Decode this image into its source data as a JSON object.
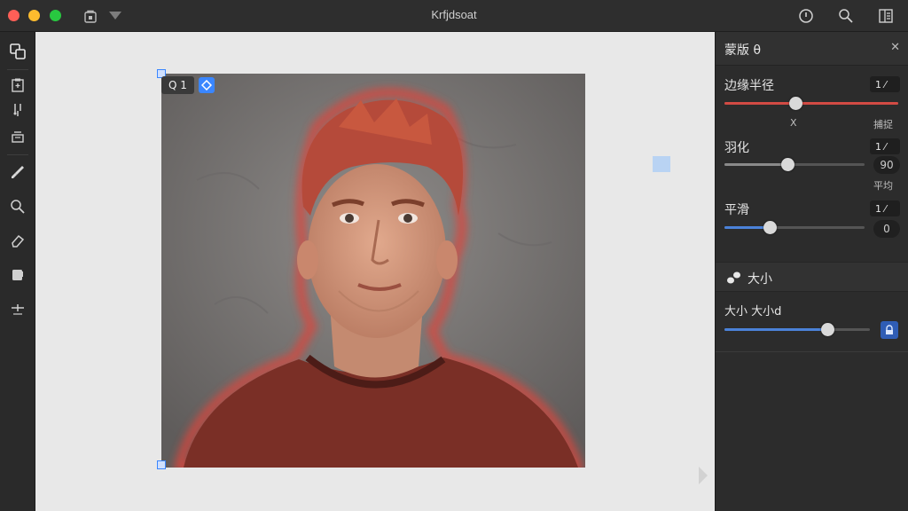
{
  "window": {
    "title": "Krfjdsoat"
  },
  "colors": {
    "accent": "#3a86ff",
    "hair_tint": "#b54a3a",
    "edge_slider": "#d24b44",
    "blue_slider": "#4b82d9"
  },
  "titlebar_icons": [
    "file-lock-icon",
    "filter-icon",
    "timer-icon",
    "search-icon",
    "layout-icon"
  ],
  "left_tools": [
    "selection-icon",
    "clipboard-icon",
    "sample-icon",
    "layers-icon",
    "brush-icon",
    "zoom-icon",
    "eraser-icon",
    "bucket-icon",
    "adjust-icon"
  ],
  "canvas": {
    "layer_badge": "Q 1"
  },
  "panel": {
    "title": "蒙版 θ",
    "close": "✕",
    "edge_radius": {
      "label": "边缘半径",
      "value": "1 ⁄",
      "level": 0.41,
      "left_note": "X",
      "right_note": "捕捉"
    },
    "feather": {
      "label": "羽化",
      "value": "1 ⁄",
      "level": 0.45,
      "pill": "90",
      "note": "平均"
    },
    "smooth": {
      "label": "平滑",
      "value": "1 ⁄",
      "level": 0.32,
      "pill": "0"
    },
    "size_section": {
      "title": "大小"
    },
    "size": {
      "label": "大小 大小d",
      "level": 0.71
    }
  }
}
